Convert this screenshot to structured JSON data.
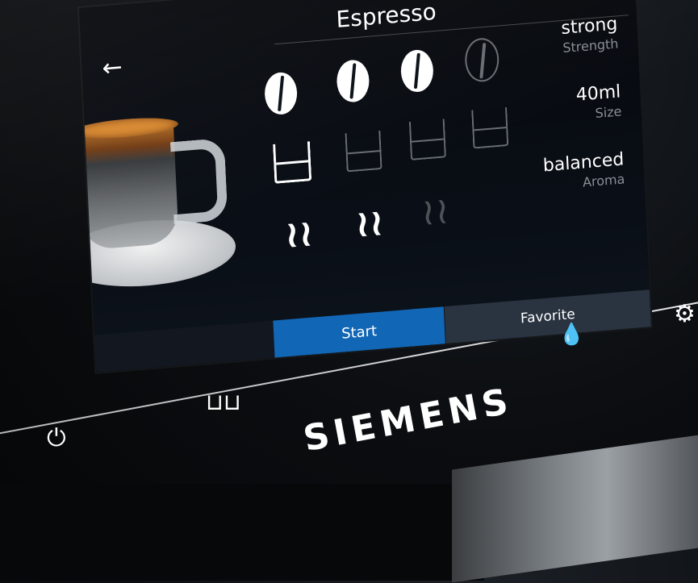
{
  "screen": {
    "title": "Espresso",
    "back_icon": "arrow-left-icon",
    "status_icons": [
      "steam-icon",
      "wifi-icon"
    ],
    "strength_beans": {
      "active": 3,
      "total": 4
    },
    "size_cups": {
      "active": 1,
      "total": 4
    },
    "aroma_steam": {
      "active": 2,
      "total": 3
    },
    "settings": [
      {
        "value": "strong",
        "label": "Strength"
      },
      {
        "value": "40ml",
        "label": "Size"
      },
      {
        "value": "balanced",
        "label": "Aroma"
      }
    ],
    "buttons": {
      "start": "Start",
      "favorite": "Favorite"
    }
  },
  "machine": {
    "brand": "SIEMENS",
    "icons": [
      "power-icon",
      "two-cups-icon",
      "water-drops-icon",
      "gear-icon"
    ]
  },
  "colors": {
    "start_button": "#1166b5",
    "favorite_button": "#2a3340"
  }
}
